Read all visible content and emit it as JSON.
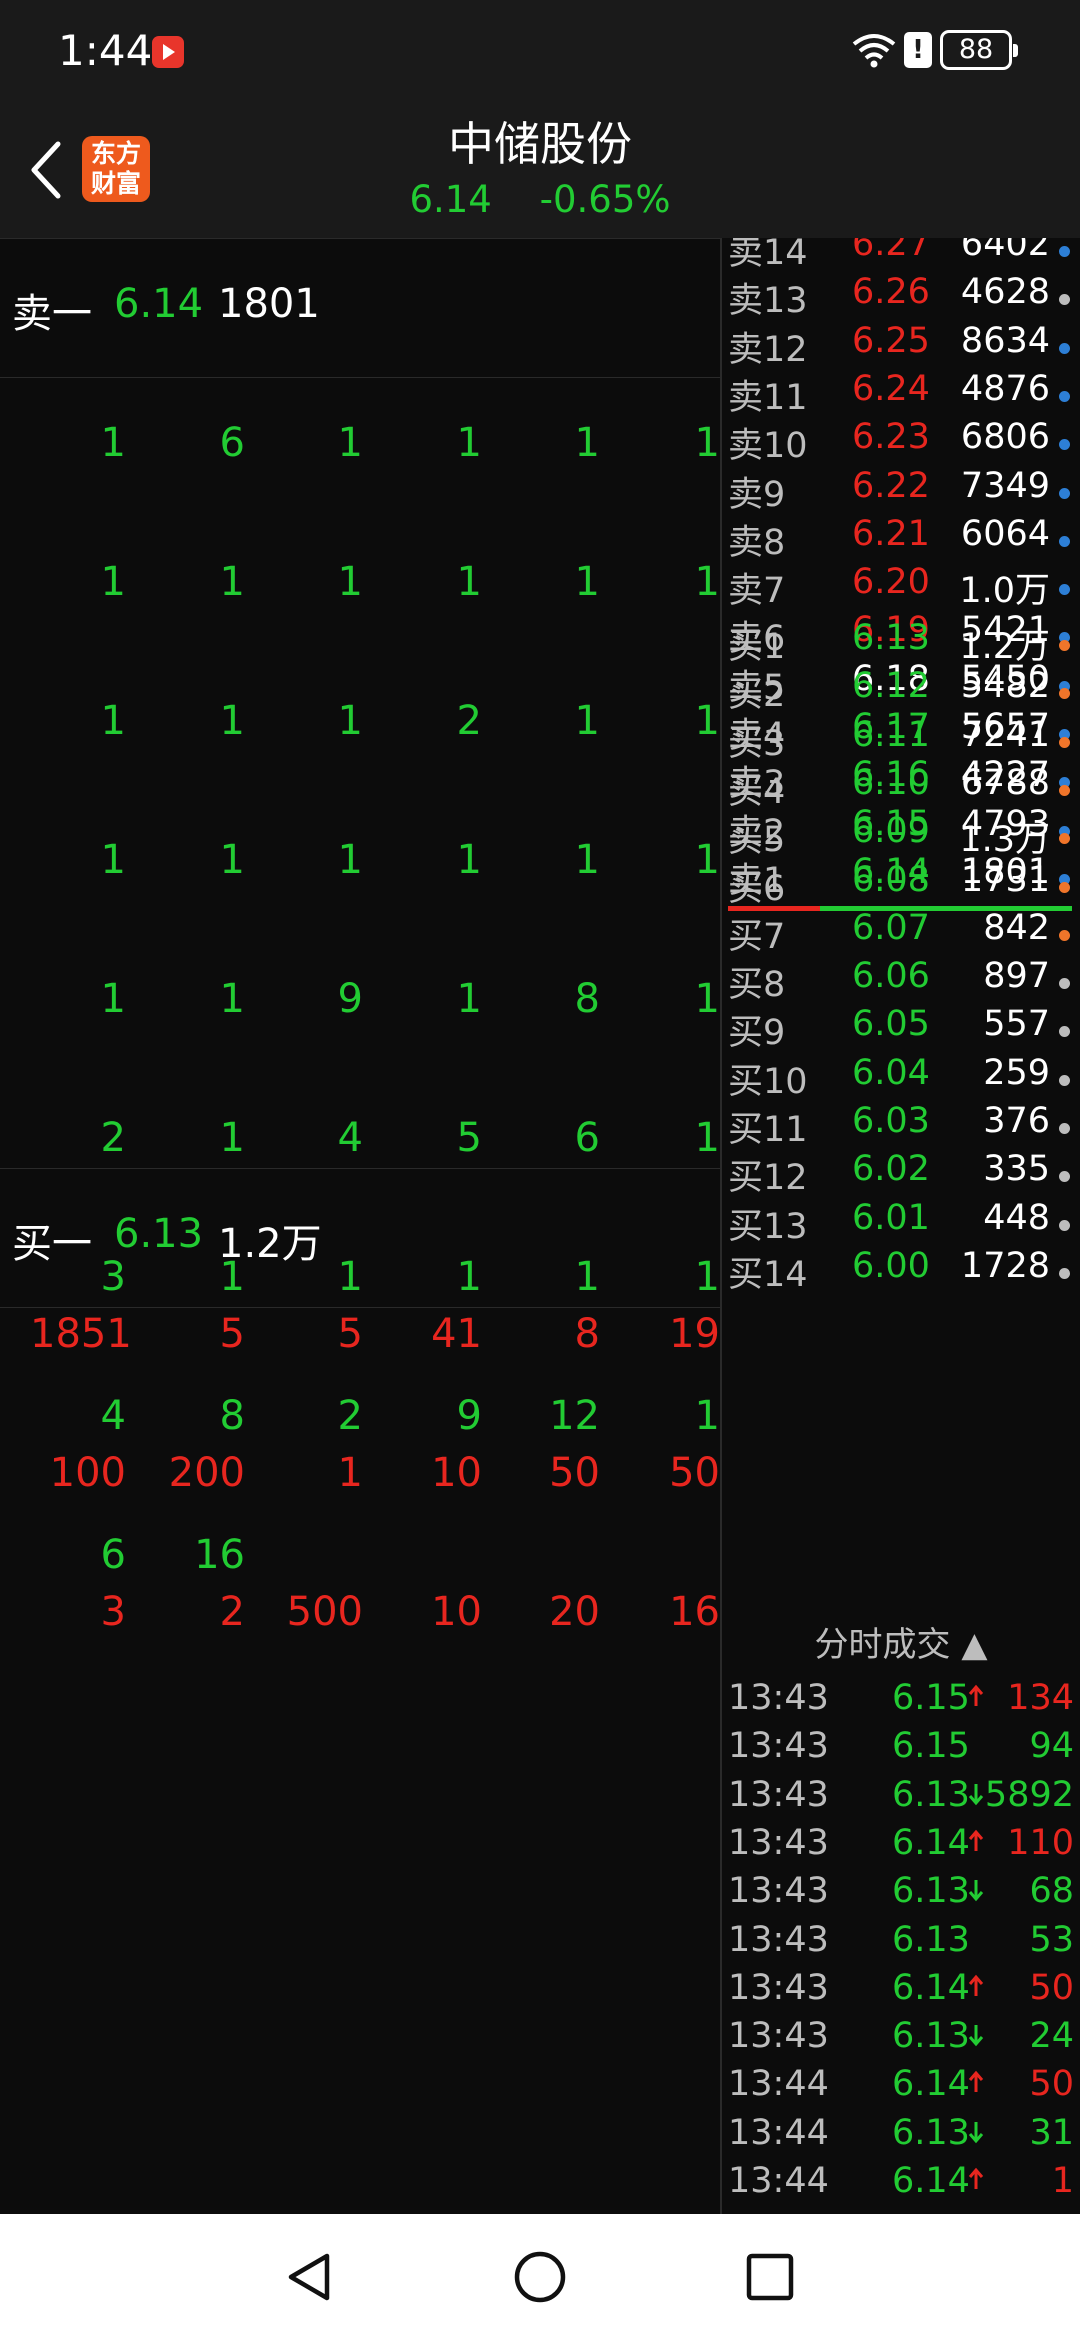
{
  "status": {
    "time": "1:44",
    "battery": "88",
    "alert": "!",
    "icons": [
      "video-app-icon",
      "wifi-icon",
      "alert-icon",
      "battery-icon"
    ]
  },
  "header": {
    "title": "中储股份",
    "price": "6.14",
    "change": "-0.65%",
    "logo_line1": "东方",
    "logo_line2": "财富",
    "back_icon": "chevron-left-icon"
  },
  "sell_one": {
    "label": "卖一",
    "price": "6.14",
    "volume": "1801"
  },
  "buy_one": {
    "label": "买一",
    "price": "6.13",
    "volume": "1.2万"
  },
  "sell_queue": [
    [
      "1",
      "6",
      "1",
      "1",
      "1",
      "1"
    ],
    [
      "1",
      "1",
      "1",
      "1",
      "1",
      "1"
    ],
    [
      "1",
      "1",
      "1",
      "2",
      "1",
      "1"
    ],
    [
      "1",
      "1",
      "1",
      "1",
      "1",
      "1"
    ],
    [
      "1",
      "1",
      "9",
      "1",
      "8",
      "1"
    ],
    [
      "2",
      "1",
      "4",
      "5",
      "6",
      "1"
    ],
    [
      "3",
      "1",
      "1",
      "1",
      "1",
      "1"
    ],
    [
      "4",
      "8",
      "2",
      "9",
      "12",
      "1"
    ],
    [
      "6",
      "16"
    ]
  ],
  "buy_queue": [
    [
      "1851",
      "5",
      "5",
      "41",
      "8",
      "19"
    ],
    [
      "100",
      "200",
      "1",
      "10",
      "50",
      "50"
    ],
    [
      "3",
      "2",
      "500",
      "10",
      "20",
      "16"
    ]
  ],
  "order_book": {
    "asks": [
      {
        "label": "卖14",
        "price": "6.27",
        "volume": "6402"
      },
      {
        "label": "卖13",
        "price": "6.26",
        "volume": "4628"
      },
      {
        "label": "卖12",
        "price": "6.25",
        "volume": "8634"
      },
      {
        "label": "卖11",
        "price": "6.24",
        "volume": "4876"
      },
      {
        "label": "卖10",
        "price": "6.23",
        "volume": "6806"
      },
      {
        "label": "卖9",
        "price": "6.22",
        "volume": "7349"
      },
      {
        "label": "卖8",
        "price": "6.21",
        "volume": "6064"
      },
      {
        "label": "卖7",
        "price": "6.20",
        "volume": "1.0万"
      },
      {
        "label": "卖6",
        "price": "6.19",
        "volume": "5421"
      },
      {
        "label": "卖5",
        "price": "6.18",
        "volume": "5450"
      },
      {
        "label": "卖4",
        "price": "6.17",
        "volume": "5657"
      },
      {
        "label": "卖3",
        "price": "6.16",
        "volume": "4227"
      },
      {
        "label": "卖2",
        "price": "6.15",
        "volume": "4793"
      },
      {
        "label": "卖1",
        "price": "6.14",
        "volume": "1801"
      }
    ],
    "ask_dot_colors": [
      "#2d7fd6",
      "#bdbdbd",
      "#2d7fd6",
      "#2d7fd6",
      "#2d7fd6",
      "#2d7fd6",
      "#2d7fd6",
      "#2d7fd6",
      "#2d7fd6",
      "#2d7fd6",
      "#2d7fd6",
      "#2d7fd6",
      "#2d7fd6",
      "#2d7fd6"
    ],
    "bids": [
      {
        "label": "买1",
        "price": "6.13",
        "volume": "1.2万"
      },
      {
        "label": "买2",
        "price": "6.12",
        "volume": "5482"
      },
      {
        "label": "买3",
        "price": "6.11",
        "volume": "7241"
      },
      {
        "label": "买4",
        "price": "6.10",
        "volume": "6788"
      },
      {
        "label": "买5",
        "price": "6.09",
        "volume": "1.3万"
      },
      {
        "label": "买6",
        "price": "6.08",
        "volume": "1731"
      },
      {
        "label": "买7",
        "price": "6.07",
        "volume": "842"
      },
      {
        "label": "买8",
        "price": "6.06",
        "volume": "897"
      },
      {
        "label": "买9",
        "price": "6.05",
        "volume": "557"
      },
      {
        "label": "买10",
        "price": "6.04",
        "volume": "259"
      },
      {
        "label": "买11",
        "price": "6.03",
        "volume": "376"
      },
      {
        "label": "买12",
        "price": "6.02",
        "volume": "335"
      },
      {
        "label": "买13",
        "price": "6.01",
        "volume": "448"
      },
      {
        "label": "买14",
        "price": "6.00",
        "volume": "1728"
      }
    ],
    "bid_dot_colors": [
      "#f0752a",
      "#f0752a",
      "#f0752a",
      "#f0752a",
      "#f0752a",
      "#f0752a",
      "#f0752a",
      "#bdbdbd",
      "#bdbdbd",
      "#bdbdbd",
      "#bdbdbd",
      "#bdbdbd",
      "#bdbdbd",
      "#bdbdbd"
    ]
  },
  "ticks": {
    "header": "分时成交 ▲",
    "rows": [
      {
        "time": "13:43",
        "price": "6.15",
        "dir": "up",
        "volume": "134"
      },
      {
        "time": "13:43",
        "price": "6.15",
        "dir": "none",
        "volume": "94"
      },
      {
        "time": "13:43",
        "price": "6.13",
        "dir": "down",
        "volume": "5892"
      },
      {
        "time": "13:43",
        "price": "6.14",
        "dir": "up",
        "volume": "110"
      },
      {
        "time": "13:43",
        "price": "6.13",
        "dir": "down",
        "volume": "68"
      },
      {
        "time": "13:43",
        "price": "6.13",
        "dir": "none",
        "volume": "53"
      },
      {
        "time": "13:43",
        "price": "6.14",
        "dir": "up",
        "volume": "50"
      },
      {
        "time": "13:43",
        "price": "6.13",
        "dir": "down",
        "volume": "24"
      },
      {
        "time": "13:44",
        "price": "6.14",
        "dir": "up",
        "volume": "50"
      },
      {
        "time": "13:44",
        "price": "6.13",
        "dir": "down",
        "volume": "31"
      },
      {
        "time": "13:44",
        "price": "6.14",
        "dir": "up",
        "volume": "1"
      }
    ]
  },
  "colors": {
    "up": "#e8261f",
    "down": "#22cc33",
    "neutral": "#ffffff"
  },
  "nav": {
    "icons": [
      "back-triangle-icon",
      "home-circle-icon",
      "recents-square-icon"
    ]
  }
}
